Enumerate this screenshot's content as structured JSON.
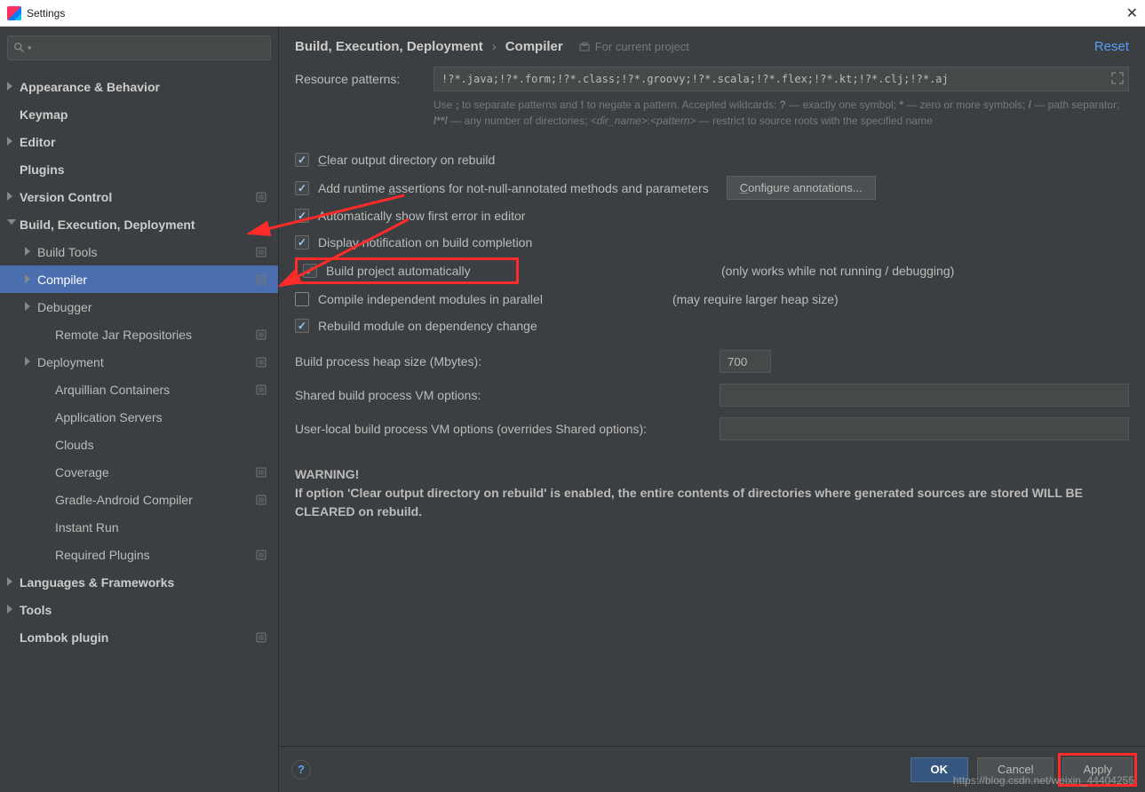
{
  "window": {
    "title": "Settings"
  },
  "search": {
    "placeholder": ""
  },
  "tree": {
    "items": [
      {
        "label": "Appearance & Behavior",
        "bold": true,
        "arrow": "r",
        "indent": 0
      },
      {
        "label": "Keymap",
        "bold": true,
        "indent": 0
      },
      {
        "label": "Editor",
        "bold": true,
        "arrow": "r",
        "indent": 0
      },
      {
        "label": "Plugins",
        "bold": true,
        "indent": 0
      },
      {
        "label": "Version Control",
        "bold": true,
        "arrow": "r",
        "indent": 0,
        "badge": true
      },
      {
        "label": "Build, Execution, Deployment",
        "bold": true,
        "arrow": "d",
        "indent": 0
      },
      {
        "label": "Build Tools",
        "arrow": "r",
        "indent": 1,
        "badge": true
      },
      {
        "label": "Compiler",
        "arrow": "r",
        "indent": 1,
        "badge": true,
        "selected": true
      },
      {
        "label": "Debugger",
        "arrow": "r",
        "indent": 1
      },
      {
        "label": "Remote Jar Repositories",
        "indent": 2,
        "badge": true
      },
      {
        "label": "Deployment",
        "arrow": "r",
        "indent": 1,
        "badge": true
      },
      {
        "label": "Arquillian Containers",
        "indent": 2,
        "badge": true
      },
      {
        "label": "Application Servers",
        "indent": 2
      },
      {
        "label": "Clouds",
        "indent": 2
      },
      {
        "label": "Coverage",
        "indent": 2,
        "badge": true
      },
      {
        "label": "Gradle-Android Compiler",
        "indent": 2,
        "badge": true
      },
      {
        "label": "Instant Run",
        "indent": 2
      },
      {
        "label": "Required Plugins",
        "indent": 2,
        "badge": true
      },
      {
        "label": "Languages & Frameworks",
        "bold": true,
        "arrow": "r",
        "indent": 0
      },
      {
        "label": "Tools",
        "bold": true,
        "arrow": "r",
        "indent": 0
      },
      {
        "label": "Lombok plugin",
        "bold": true,
        "indent": 0,
        "badge": true
      }
    ]
  },
  "breadcrumb": {
    "a": "Build, Execution, Deployment",
    "b": "Compiler",
    "proj": "For current project",
    "reset": "Reset"
  },
  "resource": {
    "label": "Resource patterns:",
    "value": "!?*.java;!?*.form;!?*.class;!?*.groovy;!?*.scala;!?*.flex;!?*.kt;!?*.clj;!?*.aj",
    "hint1": "Use ",
    "hint2": " to separate patterns and ",
    "hint3": " to negate a pattern. Accepted wildcards: ",
    "hint4": " — exactly one symbol; ",
    "hint5": " — zero or more symbols; ",
    "hint6": " — path separator; ",
    "hint7": " — any number of directories; ",
    "hint8": " — restrict to source roots with the specified name",
    "s_semicolon": ";",
    "s_bang": "!",
    "s_q": "?",
    "s_star": "*",
    "s_slash": "/",
    "s_dstar": "/**/",
    "s_dir": "<dir_name>",
    "s_col": ":",
    "s_pat": "<pattern>"
  },
  "checks": {
    "clear": "Clear output directory on rebuild",
    "runtime": "Add runtime assertions for not-null-annotated methods and parameters",
    "config_btn": "Configure annotations...",
    "autoerr": "Automatically show first error in editor",
    "notif": "Display notification on build completion",
    "build_auto": "Build project automatically",
    "build_auto_note": "(only works while not running / debugging)",
    "parallel": "Compile independent modules in parallel",
    "parallel_note": "(may require larger heap size)",
    "rebuild_dep": "Rebuild module on dependency change"
  },
  "fields": {
    "heap_lbl": "Build process heap size (Mbytes):",
    "heap_val": "700",
    "shared_lbl": "Shared build process VM options:",
    "shared_val": "",
    "user_lbl": "User-local build process VM options (overrides Shared options):",
    "user_val": ""
  },
  "warning": {
    "title": "WARNING!",
    "body": "If option 'Clear output directory on rebuild' is enabled, the entire contents of directories where generated sources are stored WILL BE CLEARED on rebuild."
  },
  "footer": {
    "ok": "OK",
    "cancel": "Cancel",
    "apply": "Apply"
  },
  "watermark": "https://blog.csdn.net/weixin_44404255"
}
